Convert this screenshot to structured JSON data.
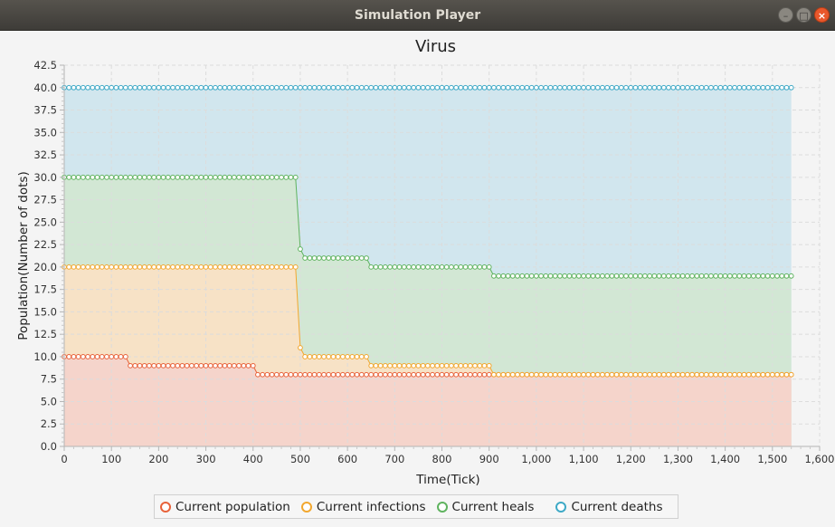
{
  "window": {
    "title": "Simulation Player",
    "buttons": [
      {
        "icon": "minimize-icon",
        "glyph": "–"
      },
      {
        "icon": "maximize-icon",
        "glyph": "□"
      },
      {
        "icon": "close-icon",
        "glyph": "×"
      }
    ]
  },
  "chart_data": {
    "type": "area",
    "title": "Virus",
    "xlabel": "Time(Tick)",
    "ylabel": "Population(Number of dots)",
    "xlim": [
      0,
      1600
    ],
    "ylim": [
      0,
      42.5
    ],
    "x_tick_step": 100,
    "y_tick_step": 2.5,
    "x_tick_labels": [
      "0",
      "100",
      "200",
      "300",
      "400",
      "500",
      "600",
      "700",
      "800",
      "900",
      "1,000",
      "1,100",
      "1,200",
      "1,300",
      "1,400",
      "1,500",
      "1,600"
    ],
    "y_tick_labels": [
      "0.0",
      "2.5",
      "5.0",
      "7.5",
      "10.0",
      "12.5",
      "15.0",
      "17.5",
      "20.0",
      "22.5",
      "25.0",
      "27.5",
      "30.0",
      "32.5",
      "35.0",
      "37.5",
      "40.0",
      "42.5"
    ],
    "grid": true,
    "legend_position": "bottom",
    "sample_step": 10,
    "x_max": 1540,
    "series": [
      {
        "name": "Current population",
        "color": "#e8623a",
        "fill": "#f5d4cb",
        "segments": [
          [
            0,
            130,
            10
          ],
          [
            140,
            400,
            9
          ],
          [
            410,
            1540,
            8
          ]
        ]
      },
      {
        "name": "Current infections",
        "color": "#f2a72e",
        "fill": "#f7e2c6",
        "segments": [
          [
            0,
            490,
            20
          ],
          [
            500,
            500,
            11
          ],
          [
            510,
            640,
            10
          ],
          [
            650,
            900,
            9
          ],
          [
            910,
            1540,
            8
          ]
        ]
      },
      {
        "name": "Current heals",
        "color": "#5fb35f",
        "fill": "#d2e7d4",
        "segments": [
          [
            0,
            490,
            30
          ],
          [
            500,
            500,
            22
          ],
          [
            510,
            640,
            21
          ],
          [
            650,
            900,
            20
          ],
          [
            910,
            1540,
            19
          ]
        ]
      },
      {
        "name": "Current deaths",
        "color": "#3ea9c6",
        "fill": "#d1e6ee",
        "segments": [
          [
            0,
            1540,
            40
          ]
        ]
      }
    ]
  }
}
